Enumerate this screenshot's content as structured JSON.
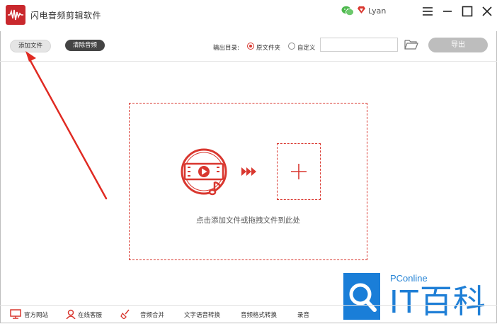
{
  "app": {
    "title": "闪电音频剪辑软件",
    "username": "Lyan"
  },
  "toolbar": {
    "add_file_label": "添加文件",
    "clear_audio_label": "清除音频",
    "output_dir_label": "输出目录:",
    "radio_original": "原文件夹",
    "radio_custom": "自定义",
    "path_value": "",
    "export_label": "导出"
  },
  "dropzone": {
    "hint": "点击添加文件或拖拽文件到此处"
  },
  "bottom": {
    "items": [
      "官方网站",
      "在线客服",
      "音频合并",
      "文字语音转换",
      "音频格式转换",
      "录音"
    ]
  },
  "watermark": {
    "pc": "PConline",
    "it": "IT百科"
  },
  "colors": {
    "accent": "#d9372f",
    "brand": "#c9282d",
    "watermark": "#1a7ed8"
  }
}
